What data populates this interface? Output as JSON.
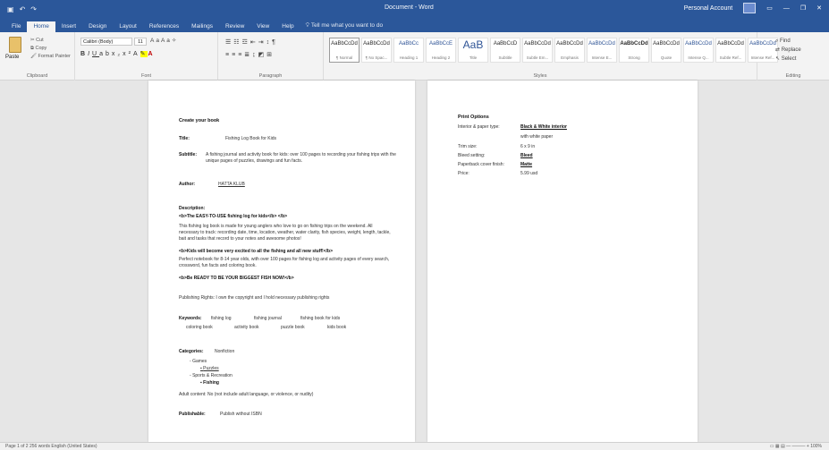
{
  "window": {
    "doc_title": "Document - Word",
    "user": "Personal Account",
    "controls": [
      "—",
      "❐",
      "✕"
    ]
  },
  "tabs": [
    "File",
    "Home",
    "Insert",
    "Design",
    "Layout",
    "References",
    "Mailings",
    "Review",
    "View",
    "Help"
  ],
  "tell_me": "Tell me what you want to do",
  "ribbon": {
    "clipboard": {
      "paste": "Paste",
      "cut": "Cut",
      "copy": "Copy",
      "painter": "Format Painter",
      "label": "Clipboard"
    },
    "font": {
      "name": "Calibri (Body)",
      "size": "11",
      "label": "Font"
    },
    "paragraph": {
      "label": "Paragraph"
    },
    "styles": {
      "label": "Styles",
      "items": [
        {
          "sample": "AaBbCcDd",
          "name": "¶ Normal"
        },
        {
          "sample": "AaBbCcDd",
          "name": "¶ No Spac..."
        },
        {
          "sample": "AaBbCc",
          "name": "Heading 1"
        },
        {
          "sample": "AaBbCcE",
          "name": "Heading 2"
        },
        {
          "sample": "AaB",
          "name": "Title"
        },
        {
          "sample": "AaBbCcD",
          "name": "Subtitle"
        },
        {
          "sample": "AaBbCcDd",
          "name": "Subtle Em..."
        },
        {
          "sample": "AaBbCcDd",
          "name": "Emphasis"
        },
        {
          "sample": "AaBbCcDd",
          "name": "Intense E..."
        },
        {
          "sample": "AaBbCcDd",
          "name": "Strong"
        },
        {
          "sample": "AaBbCcDd",
          "name": "Quote"
        },
        {
          "sample": "AaBbCcDd",
          "name": "Intense Q..."
        },
        {
          "sample": "AaBbCcDd",
          "name": "Subtle Ref..."
        },
        {
          "sample": "AaBbCcDd",
          "name": "Intense Ref..."
        }
      ]
    },
    "editing": {
      "find": "Find",
      "replace": "Replace",
      "select": "Select",
      "label": "Editing"
    }
  },
  "page1": {
    "heading": "Create your book",
    "title_label": "Title:",
    "title_value": "Fishing Log Book for Kids",
    "subtitle_label": "Subtitle:",
    "subtitle_value": "A fishing journal and activity book for kids: over 100 pages to recording your fishing trips with the unique pages of puzzles, drawings and fun facts.",
    "author_label": "Author:",
    "author_value": "HATTA KLUB",
    "description_label": "Description:",
    "desc_lines": [
      "<b>The EASY-TO-USE fishing log for kids</b> </b>",
      "This fishing log book is made for young anglers who love to go on fishing trips on the weekend. All necessary to track: recording date, time, location, weather, water clarity, fish species, weight, length, tackle, bait and tasks that record to your notes and awesome photos!",
      "<b>Kids will become very excited to all the fishing and all new stuff!</b>",
      "Perfect notebook for 8-14 year olds, with over 100 pages for fishing log and activity pages of every search, crossword, fun facts and coloring book.",
      "<b>Be READY TO BE YOUR BIGGEST FISH NOW!</b>"
    ],
    "publishing_rights": "Publishing Rights: I own the copyright and I hold necessary publishing rights",
    "keywords_label": "Keywords:",
    "keywords": [
      "fishing log",
      "fishing journal",
      "fishing book for kids",
      "coloring book",
      "activity book",
      "puzzle book",
      "kids book"
    ],
    "categories_label": "Categories:",
    "categories_value": "Nonfiction",
    "category_lines": [
      "Games",
      "Puzzles",
      "Sports & Recreation",
      "Fishing"
    ],
    "adult_note": "Adult content: No (not include adult language, or violence, or nudity)",
    "publishable_label": "Publishable:",
    "publishable_value": "Publish without ISBN"
  },
  "page2": {
    "heading": "Print Options",
    "rows": [
      {
        "label": "Interior & paper type:",
        "value": "Black & White interior",
        "underline": true
      },
      {
        "label": "",
        "value": "with white paper",
        "underline": false
      },
      {
        "label": "Trim size:",
        "value": "6 x 9 in",
        "underline": false
      },
      {
        "label": "Bleed setting:",
        "value": "Bleed",
        "underline": true
      },
      {
        "label": "Paperback cover finish:",
        "value": "Matte",
        "underline": true
      },
      {
        "label": "Price:",
        "value": "5.99 usd",
        "underline": false
      }
    ]
  },
  "status": {
    "left": "Page 1 of 2   256 words   English (United States)",
    "right": "▭  ▦  ▤   —  ———  +  100%"
  }
}
